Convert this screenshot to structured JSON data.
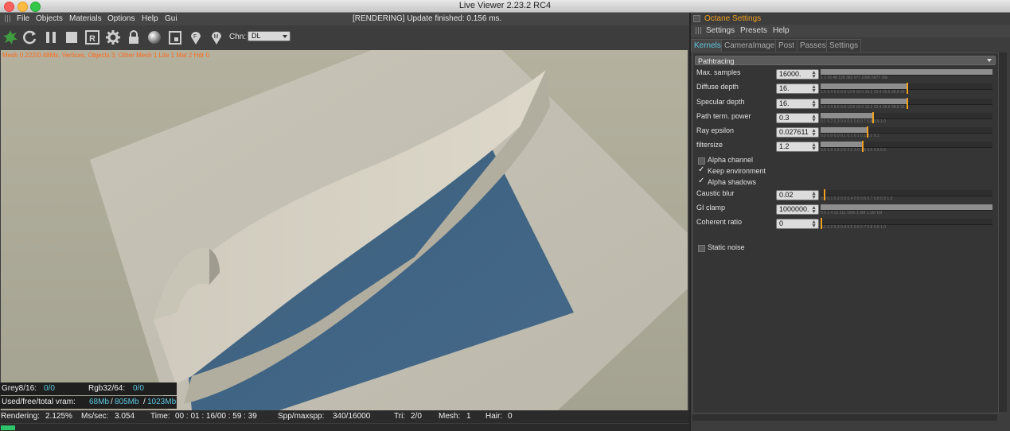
{
  "window": {
    "title": "Live Viewer 2.23.2 RC4"
  },
  "menu": {
    "items": [
      "File",
      "Objects",
      "Materials",
      "Options",
      "Help",
      "Gui"
    ],
    "status": "[RENDERING] Update finished: 0.156 ms."
  },
  "toolbar": {
    "icons": [
      "octane-logo-icon",
      "refresh-icon",
      "pause-icon",
      "stop-icon",
      "region-render-icon",
      "settings-gear-icon",
      "lock-icon",
      "material-sphere-icon",
      "clay-mode-icon",
      "focus-pick-icon",
      "material-pick-icon"
    ],
    "chn_label": "Chn:",
    "chn_value": "DL"
  },
  "overlay": {
    "stats": "Mesh 0.222/0.48Ms, Vertices, Objects 3, Other Mesh 1 Lite 1 Mat 2 Hdr 0",
    "grey_label": "Grey8/16:",
    "grey_value": "0/0",
    "rgb_label": "Rgb32/64:",
    "rgb_value": "0/0",
    "vram_label": "Used/free/total vram:",
    "vram_used": "68Mb",
    "vram_free": "805Mb",
    "vram_total": "1023Mb",
    "slash": "/"
  },
  "footer": {
    "rendering_label": "Rendering:",
    "rendering_value": "2.125%",
    "mssec_label": "Ms/sec:",
    "mssec_value": "3.054",
    "time_label": "Time:",
    "time_value": "00 : 01 : 16/00 : 59 : 39",
    "spp_label": "Spp/maxspp:",
    "spp_value": "340/16000",
    "tri_label": "Tri:",
    "tri_value": "2/0",
    "mesh_label": "Mesh:",
    "mesh_value": "1",
    "hair_label": "Hair:",
    "hair_value": "0",
    "progress": 0.02125
  },
  "settings": {
    "title": "Octane Settings",
    "menu": [
      "Settings",
      "Presets",
      "Help"
    ],
    "tabs": [
      "Kernels",
      "CameraImager",
      "Post",
      "Passes",
      "Settings"
    ],
    "active_tab": "Kernels",
    "kernel": "Pathtracing",
    "params": [
      {
        "label": "Max. samples",
        "value": "16000.",
        "fill": 1.0,
        "handle": null,
        "ticks": "1  2  16  48  128  383  977  2386  5677  16k"
      },
      {
        "label": "Diffuse depth",
        "value": "16.",
        "fill": 0.5,
        "handle": 0.5,
        "ticks": "1.0  3.4  6.6  9.8  12.8  16.0  19.2  22.4  25.6  28.8  32"
      },
      {
        "label": "Specular depth",
        "value": "16.",
        "fill": 0.5,
        "handle": 0.5,
        "ticks": "1.0  3.4  6.6  9.8  12.8  16.0  19.2  22.4  25.6  28.8  32"
      },
      {
        "label": "Path term. power",
        "value": "0.3",
        "fill": 0.3,
        "handle": 0.3,
        "ticks": "0.1  0.2  0.3  0.4  0.5  0.6  0.7  0.8  0.9  1.0"
      },
      {
        "label": "Ray epsilon",
        "value": "0.027611",
        "fill": 0.27,
        "handle": 0.27,
        "ticks": "0.0  0.0  0.0  0.1  0.1  0.1  0.1  0.1  0.1"
      },
      {
        "label": "filtersize",
        "value": "1.2",
        "fill": 0.24,
        "handle": 0.24,
        "ticks": "0.5  1.0  1.5  2.0  2.5  3.0  3.5  4.0  4.5  5.0"
      }
    ],
    "checks": [
      {
        "label": "Alpha channel",
        "checked": false
      },
      {
        "label": "Keep environment",
        "checked": true
      },
      {
        "label": "Alpha shadows",
        "checked": true
      }
    ],
    "params2": [
      {
        "label": "Caustic blur",
        "value": "0.02",
        "fill": 0.0,
        "handle": 0.02,
        "ticks": "0.0  0.1  0.2  0.3  0.4  0.5  0.6  0.7  0.8  0.9  1.0"
      },
      {
        "label": "GI clamp",
        "value": "1000000.",
        "fill": 1.0,
        "handle": null,
        "ticks": "0  0  1  4  12  211  100k  1.6M  1.1M  1M"
      },
      {
        "label": "Coherent ratio",
        "value": "0",
        "fill": 0.0,
        "handle": 0.0,
        "ticks": "0.1  0.2  0.3  0.4  0.5  0.6  0.7  0.8  0.9  1.0"
      }
    ],
    "static_noise": {
      "label": "Static noise",
      "checked": false
    },
    "check_mark": "✓"
  }
}
